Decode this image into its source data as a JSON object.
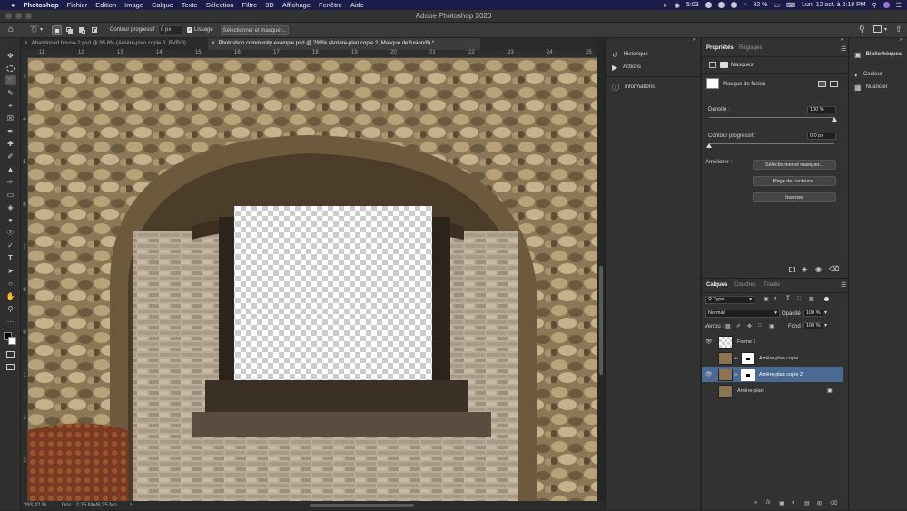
{
  "menubar": {
    "apple": "",
    "items": [
      "Photoshop",
      "Fichier",
      "Edition",
      "Image",
      "Calque",
      "Texte",
      "Sélection",
      "Filtre",
      "3D",
      "Affichage",
      "Fenêtre",
      "Aide"
    ],
    "status_time_small": "5:03",
    "battery": "82 %",
    "datetime": "Lun. 12 oct. à 2:18 PM"
  },
  "window": {
    "title": "Adobe Photoshop 2020"
  },
  "options": {
    "contour_label": "Contour progressif :",
    "contour_value": "0 px",
    "lissage_label": "Lissage",
    "select_mask_button": "Sélectionner et masquer..."
  },
  "tabs": [
    {
      "label": "Abandoned house-2.psd @ 95,8% (Arrière-plan copie 3, RVB/8)"
    },
    {
      "label": "Photoshop community example.psd @ 293% (Arrière-plan copie 2, Masque de fusion/8) *"
    }
  ],
  "ruler": {
    "h": [
      "11",
      "12",
      "13",
      "14",
      "15",
      "16",
      "17",
      "18",
      "19",
      "20",
      "21",
      "22",
      "23",
      "24",
      "25"
    ],
    "v": [
      "3",
      "4",
      "5",
      "6",
      "7",
      "8",
      "9",
      "1",
      "2",
      "3"
    ]
  },
  "status": {
    "zoom": "293,42 %",
    "doc": "Doc : 2,25 Mo/8,25 Mo"
  },
  "history_panel": {
    "items": [
      {
        "label": "Historique",
        "icon": "history-icon"
      },
      {
        "label": "Actions",
        "icon": "play-icon"
      },
      {
        "label": "Informations",
        "icon": "info-icon"
      }
    ]
  },
  "properties": {
    "tabs": [
      "Propriétés",
      "Réglages"
    ],
    "masks_label": "Masques",
    "mask_name": "Masque de fusion",
    "density_label": "Densité :",
    "density_value": "100 %",
    "density_fraction": 1.0,
    "feather_label": "Contour progressif :",
    "feather_value": "0,0 px",
    "feather_fraction": 0.0,
    "refine_label": "Améliorer :",
    "buttons": [
      "Sélectionner et masquer...",
      "Plage de couleurs...",
      "Inverser"
    ]
  },
  "layers": {
    "tabs": [
      "Calques",
      "Couches",
      "Tracés"
    ],
    "filter_label": "Type",
    "blend_mode": "Normal",
    "opacity_label": "Opacité :",
    "opacity_value": "100 %",
    "lock_label": "Verrou :",
    "fill_label": "Fond :",
    "fill_value": "100 %",
    "items": [
      {
        "name": "Forme 1",
        "visible": true,
        "selected": false,
        "has_mask": false
      },
      {
        "name": "Arrière-plan copie",
        "visible": false,
        "selected": false,
        "has_mask": true
      },
      {
        "name": "Arrière-plan copie 2",
        "visible": true,
        "selected": true,
        "has_mask": true
      },
      {
        "name": "Arrière-plan",
        "visible": false,
        "selected": false,
        "has_mask": false,
        "locked": true
      }
    ]
  },
  "libraries": {
    "items": [
      {
        "label": "Bibliothèques",
        "icon": "libraries-icon"
      },
      {
        "label": "Couleur",
        "icon": "color-icon"
      },
      {
        "label": "Nuancier",
        "icon": "swatches-icon"
      }
    ]
  },
  "colors": {
    "accent": "#4a6fa5",
    "menubar": "#1c1c4a",
    "selected_layer": "#4a6a94"
  }
}
